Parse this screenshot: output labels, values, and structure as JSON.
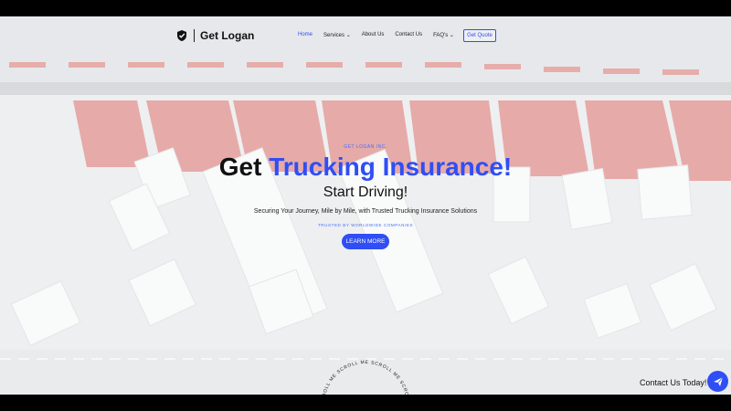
{
  "brand": {
    "name": "Get Logan"
  },
  "nav": {
    "items": [
      {
        "label": "Home"
      },
      {
        "label": "Services ⌄"
      },
      {
        "label": "About Us"
      },
      {
        "label": "Contact Us"
      },
      {
        "label": "FAQ's ⌄"
      }
    ],
    "cta": "Get Quote"
  },
  "hero": {
    "eyebrow": "GET LOGAN INC.",
    "title_plain": "Get ",
    "title_accent": "Trucking Insurance!",
    "subtitle": "Start Driving!",
    "description": "Securing Your Journey, Mile by Mile, with Trusted Trucking Insurance Solutions",
    "trusted": "TRUSTED BY WORLDWIDE COMPANIES",
    "button": "LEARN MORE"
  },
  "scroll": {
    "text": "SCROLL ME SCROLL ME SCROLL ME SCROLL ME"
  },
  "contact": {
    "label": "Contact Us Today!"
  },
  "colors": {
    "accent": "#2f4ef5"
  }
}
